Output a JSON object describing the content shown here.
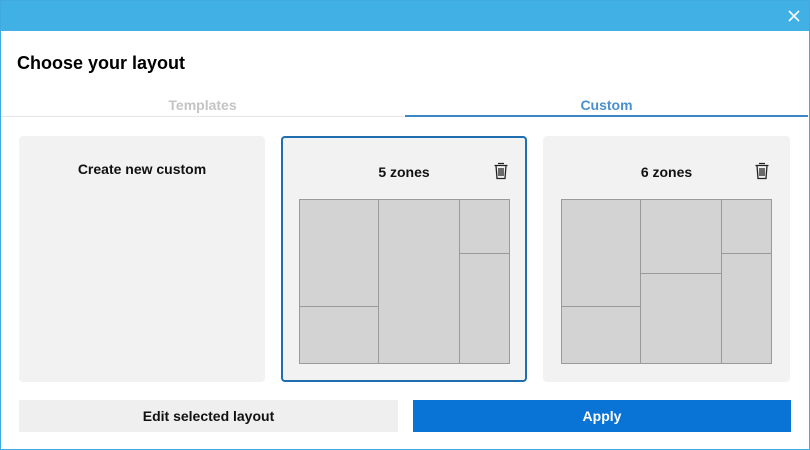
{
  "window": {
    "title": "",
    "close_label": "✕"
  },
  "heading": "Choose your layout",
  "tabs": [
    {
      "label": "Templates",
      "selected": false
    },
    {
      "label": "Custom",
      "selected": true
    }
  ],
  "cards": [
    {
      "title": "Create new custom",
      "selected": false
    },
    {
      "title": "5 zones",
      "selected": true,
      "zones": 5
    },
    {
      "title": "6 zones",
      "selected": false,
      "zones": 6
    }
  ],
  "buttons": {
    "edit_label": "Edit selected layout",
    "apply_label": "Apply"
  },
  "colors": {
    "titlebar": "#41b0e4",
    "accent": "#0a74d6",
    "tab_active": "#4a90d0",
    "tab_inactive": "#c4c4c4",
    "card_bg": "#f2f2f2",
    "zone_fill": "#d3d3d3"
  },
  "icons": {
    "close": "close-icon",
    "delete": "trash-icon"
  }
}
